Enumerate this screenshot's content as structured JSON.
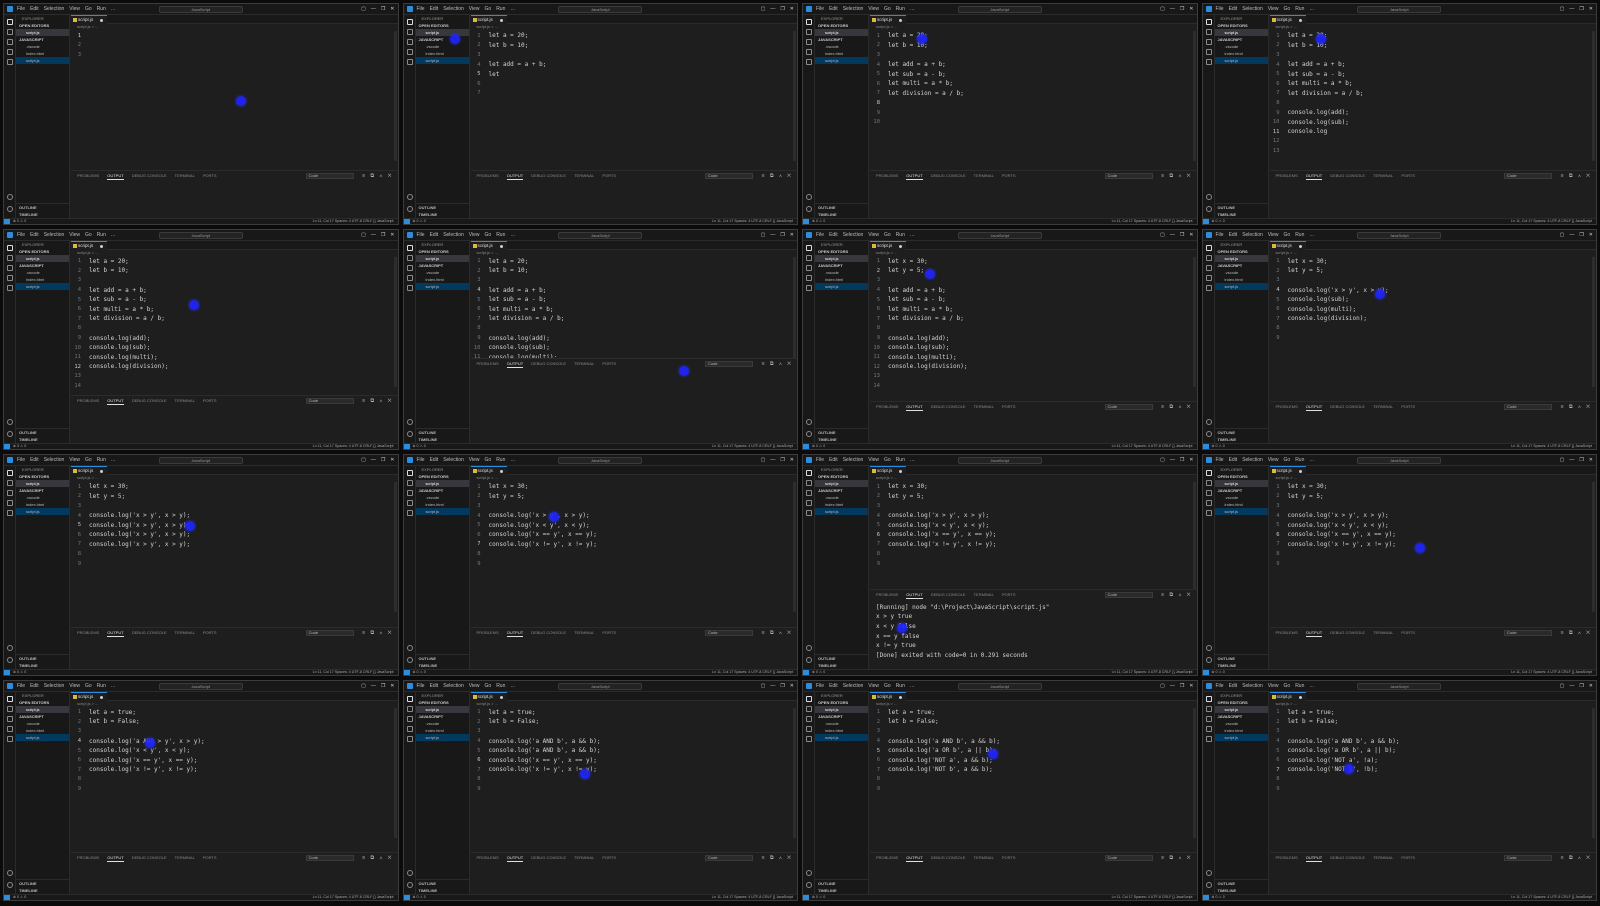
{
  "app": {
    "menu": [
      "File",
      "Edit",
      "Selection",
      "View",
      "Go",
      "Run",
      "…"
    ],
    "search_text": "JavaScript",
    "window_controls": [
      "▢",
      "—",
      "❐",
      "✕"
    ]
  },
  "sidebar": {
    "title": "EXPLORER",
    "open_editors": "OPEN EDITORS",
    "open_file": "script.js",
    "project": "JAVASCRIPT",
    "files": [
      ".vscode",
      "index.html",
      "script.js"
    ],
    "outline": "OUTLINE",
    "timeline": "TIMELINE"
  },
  "editor": {
    "tab_label": "script.js",
    "breadcrumb": "script.js > ..."
  },
  "panel": {
    "tabs": [
      "PROBLEMS",
      "OUTPUT",
      "DEBUG CONSOLE",
      "TERMINAL",
      "PORTS"
    ],
    "active_tab": "OUTPUT",
    "dropdown": "Code",
    "controls": "≡ ⧉ ∧ ✕"
  },
  "status": {
    "left": "⊗ 0 ⚠ 0",
    "right": "Ln 11, Col 17   Spaces: 4   UTF-8   CRLF   {} JavaScript"
  },
  "frames": [
    {
      "lines": [
        "",
        "",
        ""
      ],
      "current": 1,
      "output": [],
      "cursor": [
        0.6,
        0.44
      ]
    },
    {
      "lines": [
        "let a = 20;",
        "let b = 10;",
        "",
        "let add = a + b;",
        "let ",
        "",
        ""
      ],
      "current": 5,
      "output": [],
      "cursor": [
        0.13,
        0.16
      ]
    },
    {
      "lines": [
        "let a = 20;",
        "let b = 10;",
        "",
        "let add = a + b;",
        "let sub = a - b;",
        "let multi = a * b;",
        "let division = a / b;",
        "",
        "",
        ""
      ],
      "current": 8,
      "output": [],
      "cursor": [
        0.3,
        0.16
      ]
    },
    {
      "lines": [
        "let a = 20;",
        "let b = 10;",
        "",
        "let add = a + b;",
        "let sub = a - b;",
        "let multi = a * b;",
        "let division = a / b;",
        "",
        "console.log(add);",
        "console.log(sub);",
        "console.log",
        "",
        ""
      ],
      "current": 11,
      "output": [],
      "cursor": [
        0.3,
        0.16
      ]
    },
    {
      "lines": [
        "let a = 20;",
        "let b = 10;",
        "",
        "let add = a + b;",
        "let sub = a - b;",
        "let multi = a * b;",
        "let division = a / b;",
        "",
        "console.log(add);",
        "console.log(sub);",
        "console.log(multi);",
        "console.log(division);",
        "",
        ""
      ],
      "current": 12,
      "output": [],
      "cursor": [
        0.48,
        0.34
      ]
    },
    {
      "lines": [
        "let a = 20;",
        "let b = 10;",
        "",
        "let add = a + b;",
        "let sub = a - b;",
        "let multi = a * b;",
        "let division = a / b;",
        "",
        "console.log(add);",
        "console.log(sub);",
        "console.log(multi);"
      ],
      "current": 4,
      "output": [],
      "cursor": [
        0.71,
        0.64
      ]
    },
    {
      "lines": [
        "let x = 30;",
        "let y = 5;",
        "",
        "let add = a + b;",
        "let sub = a - b;",
        "let multi = a * b;",
        "let division = a / b;",
        "",
        "console.log(add);",
        "console.log(sub);",
        "console.log(multi);",
        "console.log(division);",
        "",
        ""
      ],
      "current": 2,
      "output": [],
      "cursor": [
        0.32,
        0.2
      ]
    },
    {
      "lines": [
        "let x = 30;",
        "let y = 5;",
        "",
        "console.log('x > y', x > y);",
        "console.log(sub);",
        "console.log(multi);",
        "console.log(division);",
        "",
        ""
      ],
      "current": 4,
      "output": [],
      "cursor": [
        0.45,
        0.29
      ]
    },
    {
      "lines": [
        "let x = 30;",
        "let y = 5;",
        "",
        "console.log('x > y', x > y);",
        "console.log('x > y', x > y);",
        "console.log('x > y', x > y);",
        "console.log('x > y', x > y);",
        "",
        ""
      ],
      "current": 5,
      "output": [],
      "cursor": [
        0.47,
        0.32
      ]
    },
    {
      "lines": [
        "let x = 30;",
        "let y = 5;",
        "",
        "console.log('x > y', x > y);",
        "console.log('x < y', x < y);",
        "console.log('x == y', x == y);",
        "console.log('x != y', x != y);",
        "",
        ""
      ],
      "current": 7,
      "output": [],
      "cursor": [
        0.38,
        0.28
      ]
    },
    {
      "lines": [
        "let x = 30;",
        "let y = 5;",
        "",
        "console.log('x > y', x > y);",
        "console.log('x < y', x < y);",
        "console.log('x == y', x == y);",
        "console.log('x != y', x != y);",
        "",
        ""
      ],
      "current": 6,
      "output": [
        "[Running] node \"d:\\Project\\JavaScript\\script.js\"",
        "x > y true",
        "x < y false",
        "x == y false",
        "x != y true",
        "",
        "[Done] exited with code=0 in 0.291 seconds"
      ],
      "cursor": [
        0.25,
        0.78
      ]
    },
    {
      "lines": [
        "let x = 30;",
        "let y = 5;",
        "",
        "console.log('x > y', x > y);",
        "console.log('x < y', x < y);",
        "console.log('x == y', x == y);",
        "console.log('x != y', x != y);",
        "",
        ""
      ],
      "current": 6,
      "output": [],
      "cursor": [
        0.55,
        0.42
      ]
    },
    {
      "lines": [
        "let a = true;",
        "let b = False;",
        "",
        "console.log('a AND > y', x > y);",
        "console.log('x < y', x < y);",
        "console.log('x == y', x == y);",
        "console.log('x != y', x != y);",
        "",
        ""
      ],
      "current": 4,
      "output": [],
      "cursor": [
        0.37,
        0.28
      ]
    },
    {
      "lines": [
        "let a = true;",
        "let b = False;",
        "",
        "console.log('a AND b', a && b);",
        "console.log('a AND b', a && b);",
        "console.log('x == y', x == y);",
        "console.log('x != y', x != y);",
        "",
        ""
      ],
      "current": 6,
      "output": [],
      "cursor": [
        0.46,
        0.42
      ]
    },
    {
      "lines": [
        "let a = true;",
        "let b = False;",
        "",
        "console.log('a AND b', a && b);",
        "console.log('a OR b', a || b);",
        "console.log('NOT a', a && b);",
        "console.log('NOT b', a && b);",
        "",
        ""
      ],
      "current": 5,
      "output": [],
      "cursor": [
        0.48,
        0.33
      ]
    },
    {
      "lines": [
        "let a = true;",
        "let b = False;",
        "",
        "console.log('a AND b', a && b);",
        "console.log('a OR b', a || b);",
        "console.log('NOT a', !a);",
        "console.log('NOT b', !b);",
        "",
        ""
      ],
      "current": 7,
      "output": [],
      "cursor": [
        0.37,
        0.4
      ]
    }
  ]
}
